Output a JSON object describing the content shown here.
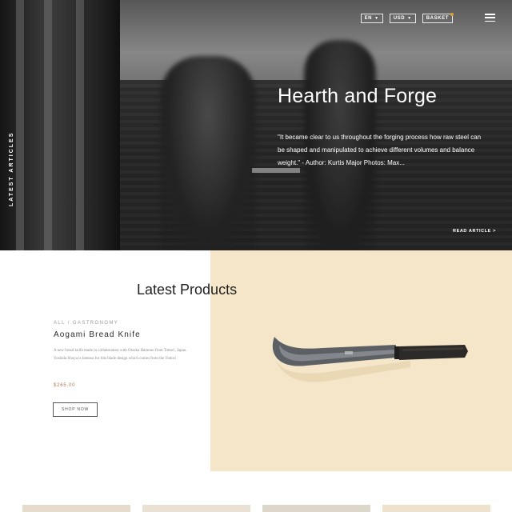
{
  "nav": {
    "language": "EN",
    "currency": "USD",
    "basket_label": "BASKET",
    "accent_color": "#e0a030"
  },
  "hero": {
    "side_label": "LATEST ARTICLES",
    "title": "Hearth and Forge",
    "quote": "\"It became clear to us throughout the forging process how raw steel can be shaped and manipulated to achieve different volumes and balance weight.\" - Author: Kurtis Major Photos: Max...",
    "read_article": "READ ARTICLE >"
  },
  "products": {
    "section_title": "Latest Products",
    "item": {
      "category": "ALL / GASTRONOMY",
      "name": "Aogami Bread Knife",
      "description_lines": [
        "A new bread knife made in collaboration with Otsuka Hamono from Tottori, Japan.",
        "Yoshida Shoya is famous for this blade design which comes from the Tottori"
      ],
      "price": "$265.00",
      "button_label": "SHOP NOW",
      "image_background": "#f5e6c9"
    }
  },
  "thumbnails": [
    {
      "color": "#e6dccd"
    },
    {
      "color": "#e9e1d4"
    },
    {
      "color": "#ddd6ca"
    },
    {
      "color": "#efe2cc"
    }
  ],
  "icons": [
    "menu-icon",
    "caret-down-icon",
    "chevron-right-icon"
  ]
}
